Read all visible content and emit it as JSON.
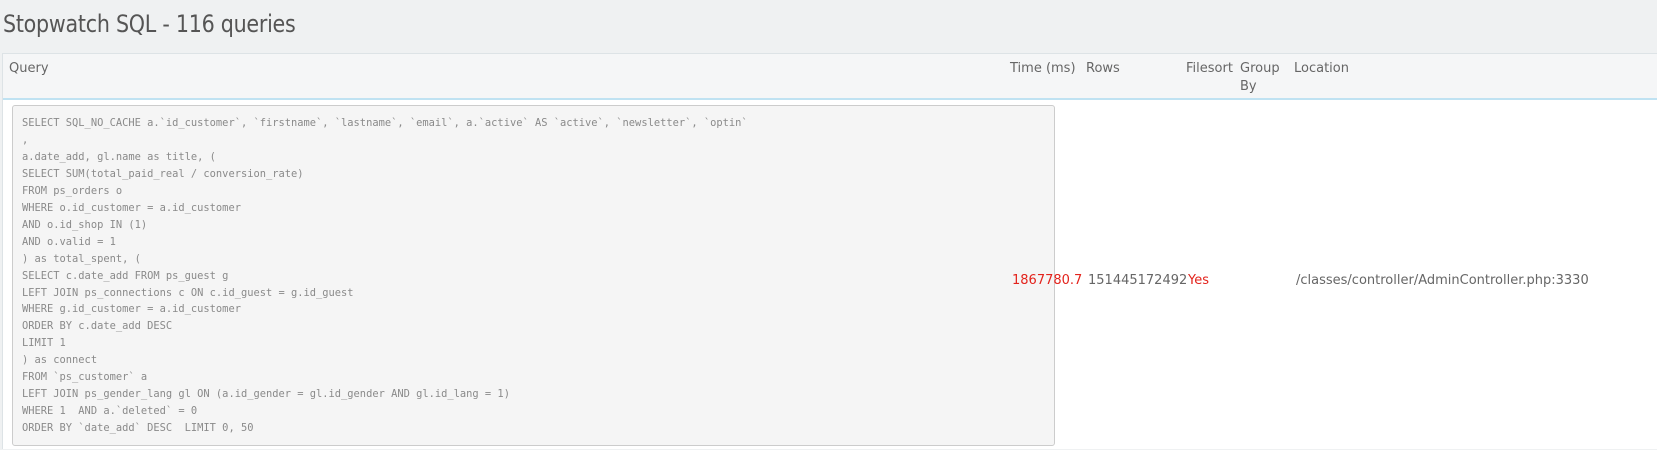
{
  "page": {
    "title": "Stopwatch SQL - 116 queries"
  },
  "table": {
    "headers": {
      "query": "Query",
      "time": "Time (ms)",
      "rows": "Rows",
      "filesort": "Filesort",
      "group_by": "Group By",
      "location": "Location"
    },
    "rows": [
      {
        "query": "SELECT SQL_NO_CACHE a.`id_customer`, `firstname`, `lastname`, `email`, a.`active` AS `active`, `newsletter`, `optin`\n,\na.date_add, gl.name as title, (\nSELECT SUM(total_paid_real / conversion_rate)\nFROM ps_orders o\nWHERE o.id_customer = a.id_customer\nAND o.id_shop IN (1)\nAND o.valid = 1\n) as total_spent, (\nSELECT c.date_add FROM ps_guest g\nLEFT JOIN ps_connections c ON c.id_guest = g.id_guest\nWHERE g.id_customer = a.id_customer\nORDER BY c.date_add DESC\nLIMIT 1\n) as connect\nFROM `ps_customer` a\nLEFT JOIN ps_gender_lang gl ON (a.id_gender = gl.id_gender AND gl.id_lang = 1)\nWHERE 1  AND a.`deleted` = 0\nORDER BY `date_add` DESC  LIMIT 0, 50",
        "time": "1867780.7",
        "rows": "151445172492",
        "filesort": "Yes",
        "group_by": "",
        "location": "/classes/controller/AdminController.php:3330"
      }
    ]
  },
  "colors": {
    "alert_red": "#e3231c",
    "header_border_blue": "#bfe2f2"
  }
}
